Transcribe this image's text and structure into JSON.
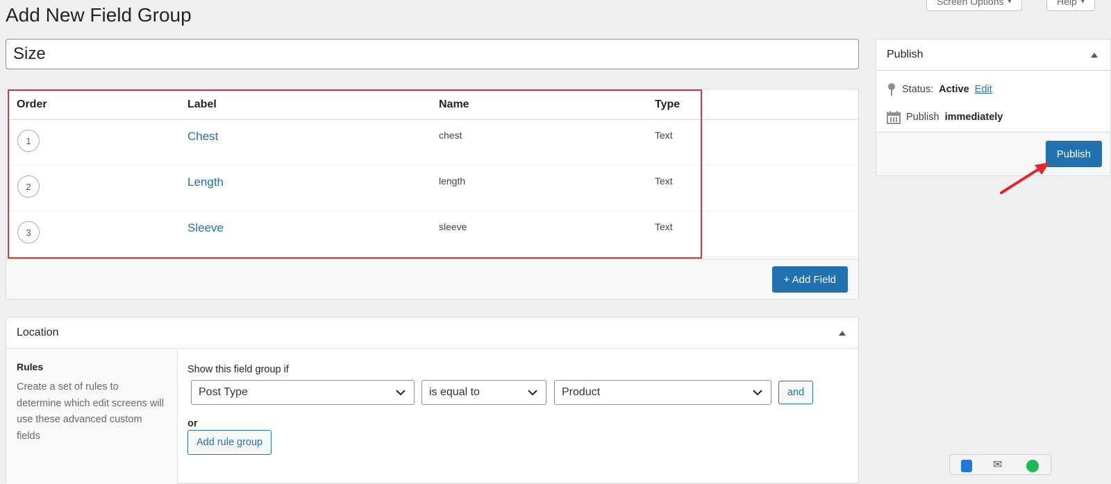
{
  "page": {
    "title": "Add New Field Group",
    "screen_options_label": "Screen Options",
    "help_label": "Help"
  },
  "title_input": {
    "value": "Size"
  },
  "fields": {
    "headers": {
      "order": "Order",
      "label": "Label",
      "name": "Name",
      "type": "Type"
    },
    "rows": [
      {
        "order": "1",
        "label": "Chest",
        "name": "chest",
        "type": "Text"
      },
      {
        "order": "2",
        "label": "Length",
        "name": "length",
        "type": "Text"
      },
      {
        "order": "3",
        "label": "Sleeve",
        "name": "sleeve",
        "type": "Text"
      }
    ],
    "add_field_label": "+ Add Field"
  },
  "location": {
    "title": "Location",
    "rules_title": "Rules",
    "rules_description": "Create a set of rules to determine which edit screens will use these advanced custom fields",
    "show_if_label": "Show this field group if",
    "param_select": "Post Type",
    "operator_select": "is equal to",
    "value_select": "Product",
    "and_label": "and",
    "or_label": "or",
    "add_rule_group_label": "Add rule group"
  },
  "publish": {
    "title": "Publish",
    "status_label": "Status:",
    "status_value": "Active",
    "edit_label": "Edit",
    "publish_label": "Publish",
    "publish_when": "immediately",
    "button_label": "Publish"
  },
  "colors": {
    "accent": "#2271b1",
    "highlight": "#d63638",
    "background": "#f0f0f1"
  },
  "icons": [
    "pin-icon",
    "calendar-icon",
    "collapse-arrow-icon",
    "chevron-down-icon",
    "red-arrow-annotation"
  ]
}
